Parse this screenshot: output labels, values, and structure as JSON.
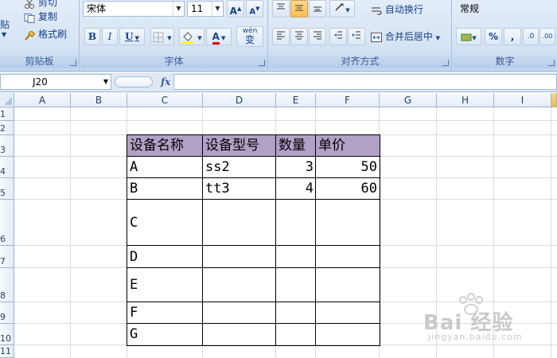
{
  "ribbon": {
    "clipboard": {
      "paste_label": "粘贴",
      "cut_label": "剪切",
      "copy_label": "复制",
      "format_painter_label": "格式刷",
      "group_label": "剪贴板"
    },
    "font": {
      "font_name": "宋体",
      "font_size": "11",
      "grow_label": "A",
      "shrink_label": "A",
      "bold_label": "B",
      "italic_label": "I",
      "underline_label": "U",
      "font_color_label": "A",
      "phonetic_label": "wén",
      "phonetic_char": "变",
      "group_label": "字体"
    },
    "alignment": {
      "wrap_text_label": "自动换行",
      "merge_center_label": "合并后居中",
      "group_label": "对齐方式"
    },
    "number": {
      "format_value": "常规",
      "percent_label": "%",
      "comma_label": ",",
      "inc_decimal_label": ".0",
      "dec_decimal_label": ".00",
      "group_label": "数字"
    }
  },
  "formula_bar": {
    "name_box": "J20",
    "fx_label": "fx",
    "formula": ""
  },
  "sheet": {
    "columns": [
      "A",
      "B",
      "C",
      "D",
      "E",
      "F",
      "G",
      "H",
      "I"
    ],
    "rows": [
      "1",
      "2",
      "3",
      "4",
      "5",
      "6",
      "7",
      "8",
      "9",
      "10",
      "11"
    ],
    "table": {
      "headers": [
        "设备名称",
        "设备型号",
        "数量",
        "单价"
      ],
      "rows": [
        [
          "A",
          "ss2",
          "3",
          "50"
        ],
        [
          "B",
          "tt3",
          "4",
          "60"
        ],
        [
          "C",
          "",
          "",
          ""
        ],
        [
          "D",
          "",
          "",
          ""
        ],
        [
          "E",
          "",
          "",
          ""
        ],
        [
          "F",
          "",
          "",
          ""
        ],
        [
          "G",
          "",
          "",
          ""
        ]
      ]
    }
  },
  "watermark": {
    "brand": "Bai 经验",
    "url": "jingyan.baidu.com"
  },
  "colors": {
    "header_fill": "#b2a1c7",
    "ribbon_bg": "#dae6f4",
    "gridline": "#dadcdd"
  }
}
